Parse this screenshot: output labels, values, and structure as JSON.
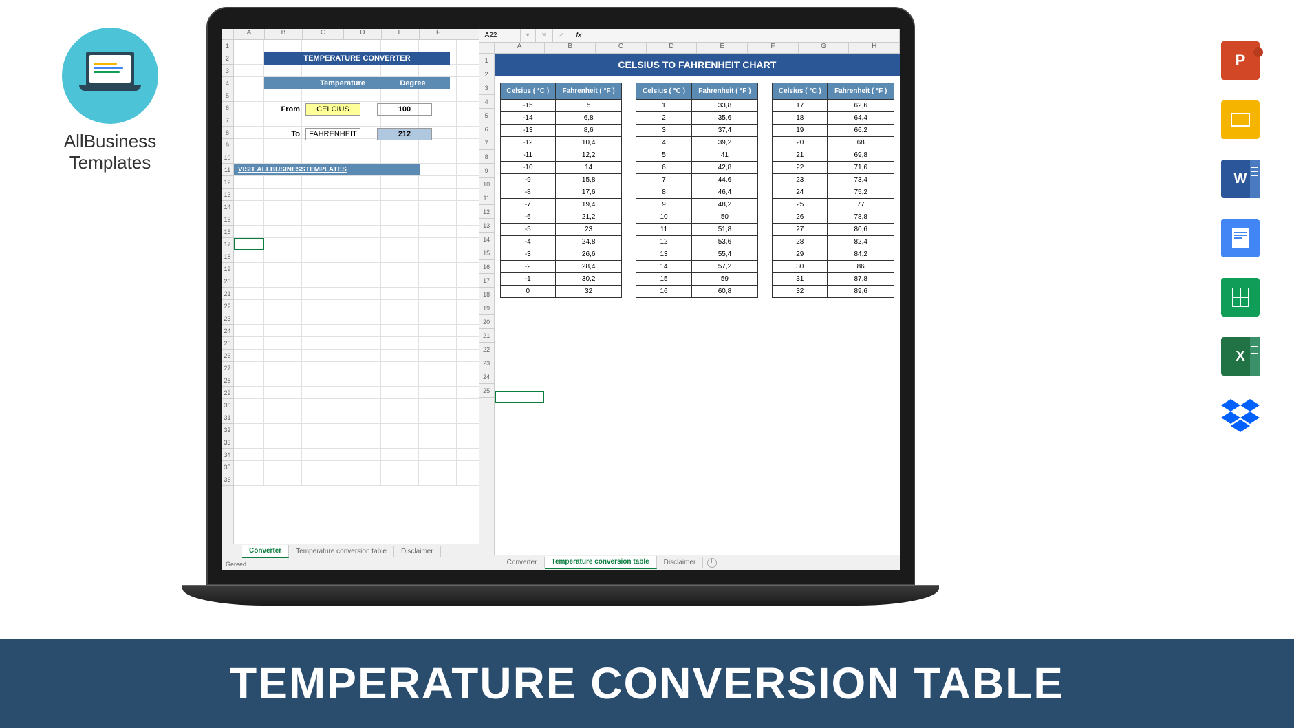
{
  "brand": {
    "name": "AllBusiness\nTemplates"
  },
  "banner": "TEMPERATURE CONVERSION TABLE",
  "app_icons": [
    {
      "name": "powerpoint",
      "label": "P",
      "color": "#d24726"
    },
    {
      "name": "slides",
      "label": "",
      "color": "#f4b400"
    },
    {
      "name": "word",
      "label": "W",
      "color": "#2b579a"
    },
    {
      "name": "docs",
      "label": "",
      "color": "#4285f4"
    },
    {
      "name": "sheets",
      "label": "",
      "color": "#0f9d58"
    },
    {
      "name": "excel",
      "label": "X",
      "color": "#217346"
    },
    {
      "name": "dropbox",
      "label": "",
      "color": "#0061ff"
    }
  ],
  "left_sheet": {
    "cols": [
      "A",
      "B",
      "C",
      "D",
      "E",
      "F"
    ],
    "rows_count": 36,
    "title": "TEMPERATURE CONVERTER",
    "header_temp": "Temperature",
    "header_degree": "Degree",
    "from_label": "From",
    "from_unit": "CELCIUS",
    "from_value": "100",
    "to_label": "To",
    "to_unit": "FAHRENHEIT",
    "to_value": "212",
    "visit_link": "VISIT ALLBUSINESSTEMPLATES",
    "tabs": [
      "Converter",
      "Temperature conversion table",
      "Disclaimer"
    ],
    "active_tab": 0,
    "status": "Gereed"
  },
  "right_sheet": {
    "formula_bar": {
      "cell": "A22",
      "fx": "fx"
    },
    "cols": [
      "A",
      "B",
      "C",
      "D",
      "E",
      "F",
      "G",
      "H"
    ],
    "rows_count": 25,
    "title": "CELSIUS TO FAHRENHEIT CHART",
    "col_celsius": "Celsius ( °C )",
    "col_fahrenheit": "Fahrenheit  ( °F )",
    "tables": [
      [
        [
          "-15",
          "5"
        ],
        [
          "-14",
          "6,8"
        ],
        [
          "-13",
          "8,6"
        ],
        [
          "-12",
          "10,4"
        ],
        [
          "-11",
          "12,2"
        ],
        [
          "-10",
          "14"
        ],
        [
          "-9",
          "15,8"
        ],
        [
          "-8",
          "17,6"
        ],
        [
          "-7",
          "19,4"
        ],
        [
          "-6",
          "21,2"
        ],
        [
          "-5",
          "23"
        ],
        [
          "-4",
          "24,8"
        ],
        [
          "-3",
          "26,6"
        ],
        [
          "-2",
          "28,4"
        ],
        [
          "-1",
          "30,2"
        ],
        [
          "0",
          "32"
        ]
      ],
      [
        [
          "1",
          "33,8"
        ],
        [
          "2",
          "35,6"
        ],
        [
          "3",
          "37,4"
        ],
        [
          "4",
          "39,2"
        ],
        [
          "5",
          "41"
        ],
        [
          "6",
          "42,8"
        ],
        [
          "7",
          "44,6"
        ],
        [
          "8",
          "46,4"
        ],
        [
          "9",
          "48,2"
        ],
        [
          "10",
          "50"
        ],
        [
          "11",
          "51,8"
        ],
        [
          "12",
          "53,6"
        ],
        [
          "13",
          "55,4"
        ],
        [
          "14",
          "57,2"
        ],
        [
          "15",
          "59"
        ],
        [
          "16",
          "60,8"
        ]
      ],
      [
        [
          "17",
          "62,6"
        ],
        [
          "18",
          "64,4"
        ],
        [
          "19",
          "66,2"
        ],
        [
          "20",
          "68"
        ],
        [
          "21",
          "69,8"
        ],
        [
          "22",
          "71,6"
        ],
        [
          "23",
          "73,4"
        ],
        [
          "24",
          "75,2"
        ],
        [
          "25",
          "77"
        ],
        [
          "26",
          "78,8"
        ],
        [
          "27",
          "80,6"
        ],
        [
          "28",
          "82,4"
        ],
        [
          "29",
          "84,2"
        ],
        [
          "30",
          "86"
        ],
        [
          "31",
          "87,8"
        ],
        [
          "32",
          "89,6"
        ]
      ]
    ],
    "tabs": [
      "Converter",
      "Temperature conversion table",
      "Disclaimer"
    ],
    "active_tab": 1
  }
}
